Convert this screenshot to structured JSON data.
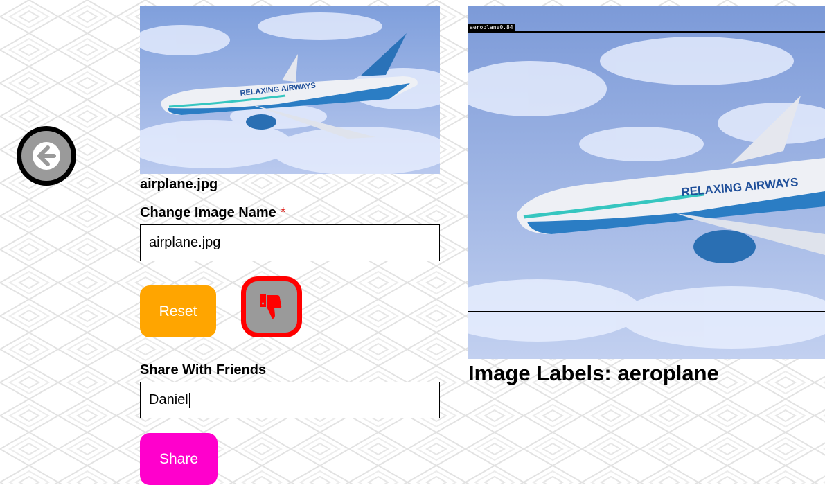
{
  "nav": {
    "back_icon": "arrow-left-icon"
  },
  "image": {
    "file_name": "airplane.jpg",
    "livery_text": "RELAXING AIRWAYS"
  },
  "rename": {
    "label": "Change Image Name",
    "required_marker": "*",
    "value": "airplane.jpg"
  },
  "actions": {
    "reset_label": "Reset",
    "dislike_icon": "thumbs-down-icon",
    "dislike_border_color": "#ff0000",
    "reset_color": "#ffa500",
    "share_color": "#ff00cc"
  },
  "share": {
    "label": "Share With Friends",
    "value": "Daniel",
    "button_label": "Share"
  },
  "detection": {
    "tag": "aeroplane0.84"
  },
  "labels": {
    "heading": "Image Labels: aeroplane"
  }
}
